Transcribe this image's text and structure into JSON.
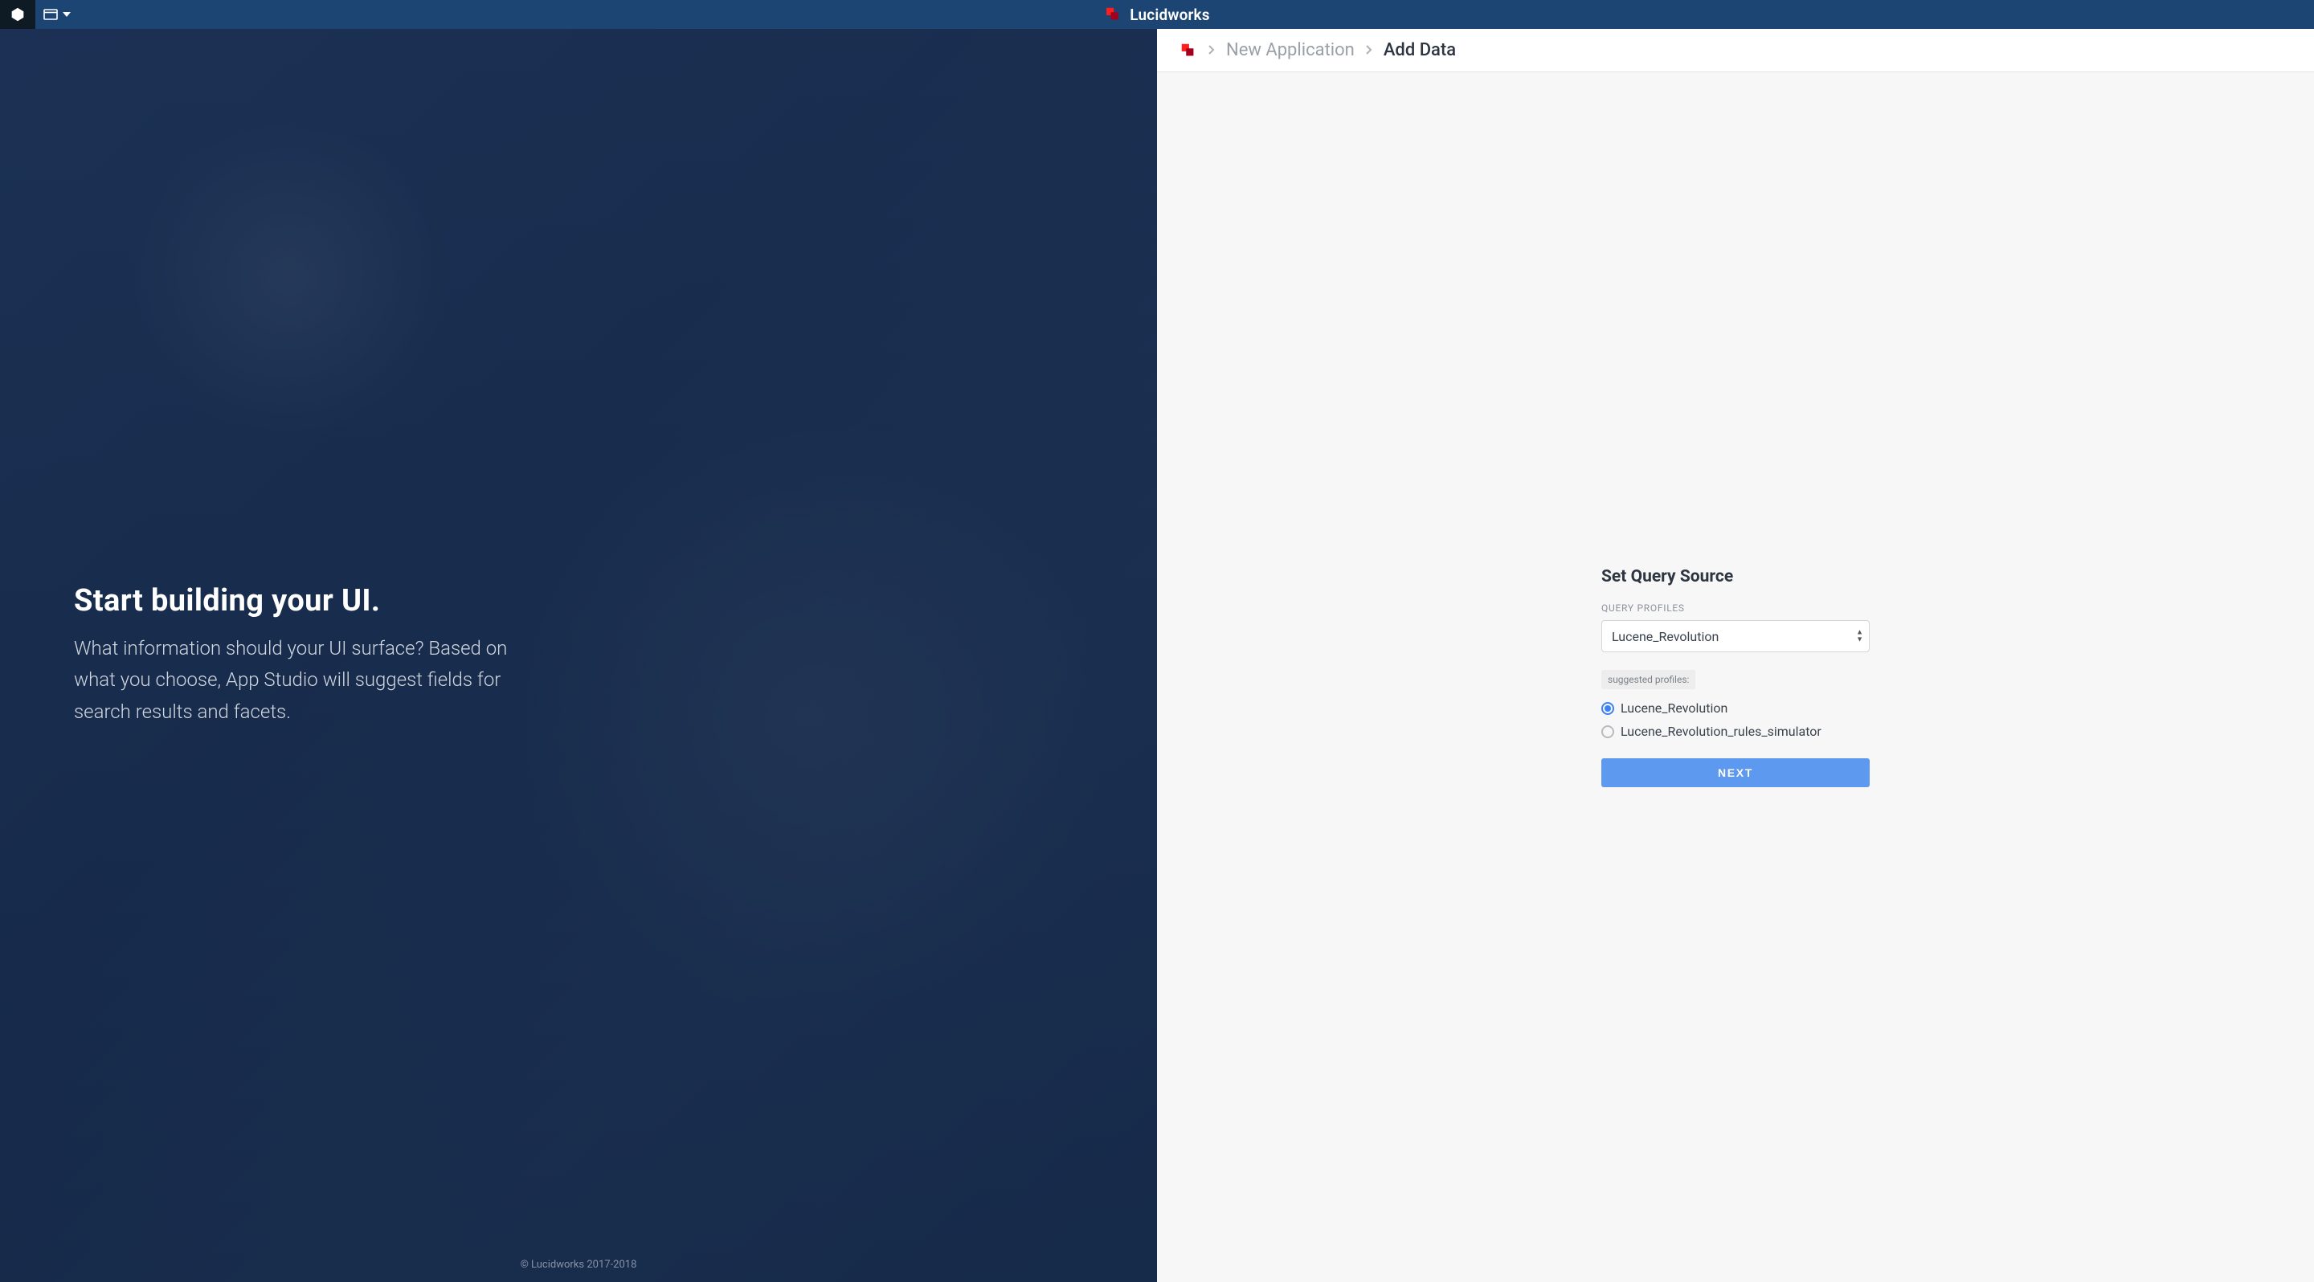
{
  "header": {
    "brand": "Lucidworks"
  },
  "breadcrumb": {
    "prev": "New Application",
    "current": "Add Data"
  },
  "left": {
    "heading": "Start building your UI.",
    "subtext": "What information should your UI surface? Based on what you choose, App Studio will suggest fields for search results and facets.",
    "copyright": "© Lucidworks 2017-2018"
  },
  "form": {
    "title": "Set Query Source",
    "profiles_label": "QUERY PROFILES",
    "selected_profile": "Lucene_Revolution",
    "suggested_chip": "suggested profiles:",
    "options": [
      {
        "label": "Lucene_Revolution",
        "selected": true
      },
      {
        "label": "Lucene_Revolution_rules_simulator",
        "selected": false
      }
    ],
    "next_label": "NEXT"
  }
}
